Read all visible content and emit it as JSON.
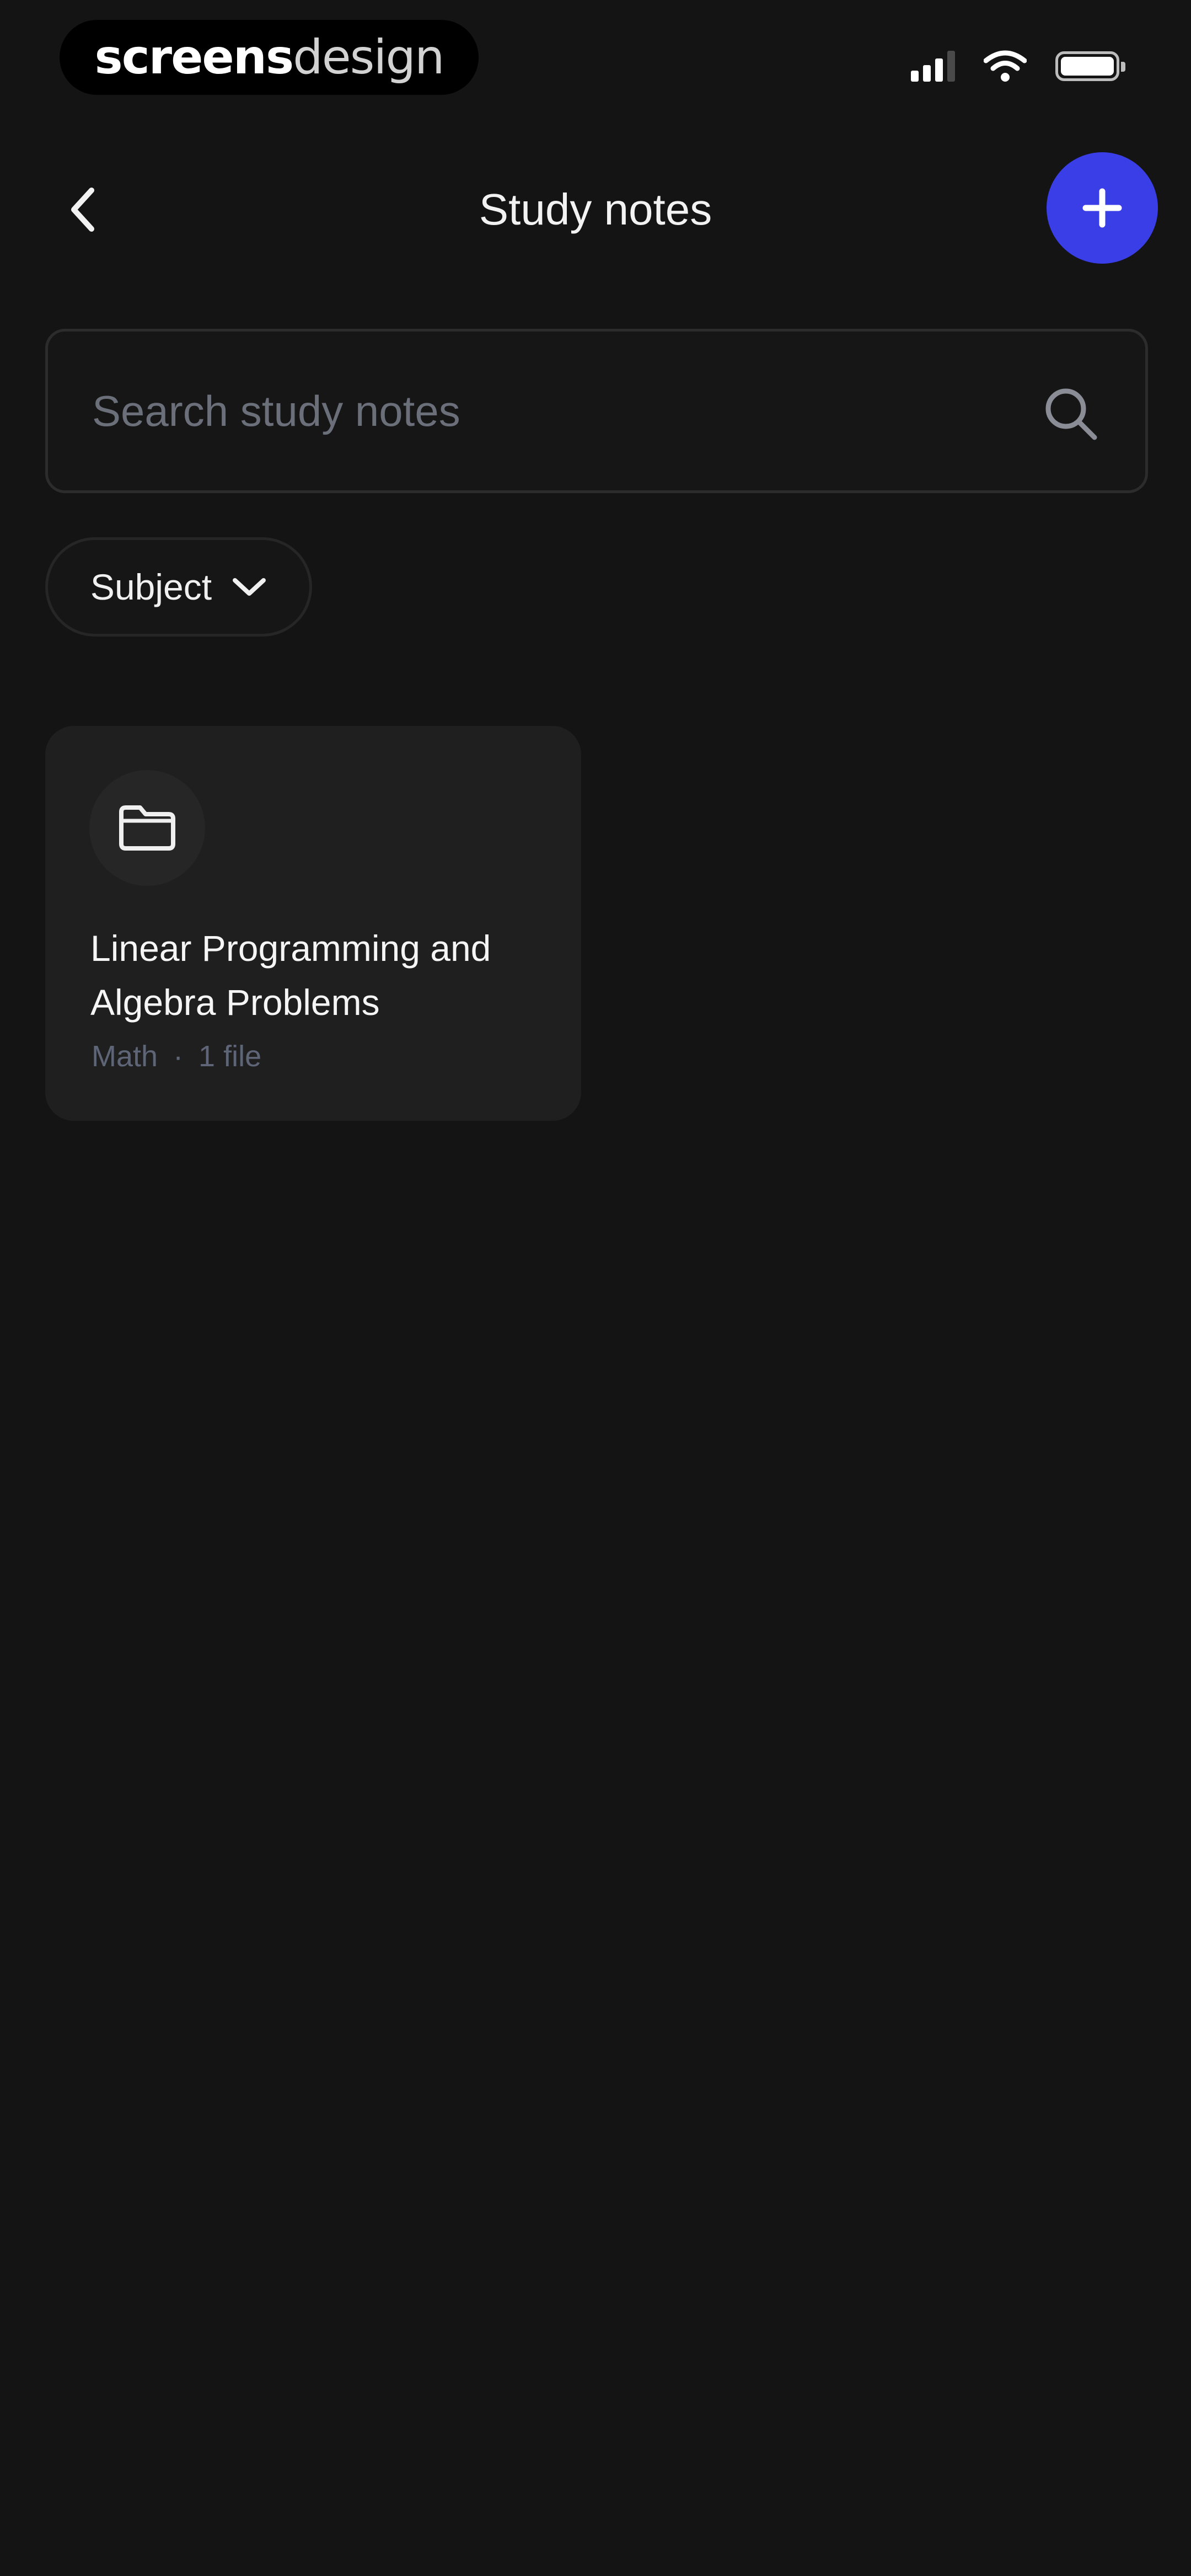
{
  "status_bar": {
    "brand_bold": "screens",
    "brand_light": "design",
    "icons": [
      "signal-icon",
      "wifi-icon",
      "battery-icon"
    ]
  },
  "header": {
    "title": "Study notes",
    "back_icon": "chevron-left-icon",
    "add_icon": "plus-icon"
  },
  "search": {
    "placeholder": "Search study notes",
    "value": "",
    "icon": "search-icon"
  },
  "filters": {
    "subject_label": "Subject",
    "icon": "chevron-down-icon"
  },
  "notes": [
    {
      "title": "Linear Programming and Algebra Problems",
      "subject": "Math",
      "separator": "·",
      "file_count": "1 file",
      "icon": "folder-icon"
    }
  ],
  "colors": {
    "background": "#141414",
    "card": "#1f1f1f",
    "accent": "#3a3ee6",
    "meta_text": "#5d6577",
    "placeholder": "#6b6f7a"
  }
}
